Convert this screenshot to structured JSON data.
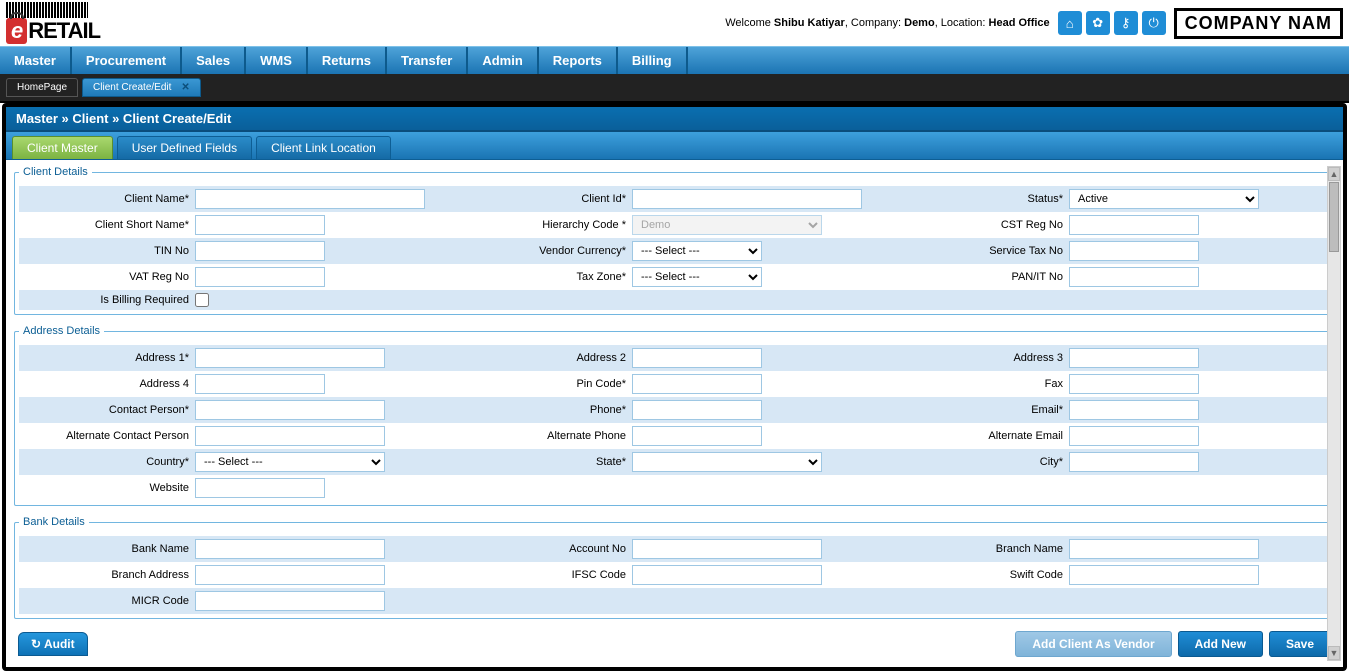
{
  "header": {
    "logo_text": "RETAIL",
    "logo_e": "e",
    "welcome_prefix": "Welcome ",
    "user": "Shibu Katiyar",
    "company_label": ", Company: ",
    "company": "Demo",
    "location_label": ", Location: ",
    "location": "Head Office",
    "company_box": "COMPANY NAM"
  },
  "menu": [
    "Master",
    "Procurement",
    "Sales",
    "WMS",
    "Returns",
    "Transfer",
    "Admin",
    "Reports",
    "Billing"
  ],
  "doc_tabs": {
    "home": "HomePage",
    "active": "Client Create/Edit"
  },
  "breadcrumb": "Master » Client » Client Create/Edit",
  "subtabs": [
    "Client Master",
    "User Defined Fields",
    "Client Link Location"
  ],
  "sections": {
    "client": {
      "legend": "Client Details",
      "labels": {
        "client_name": "Client Name*",
        "client_id": "Client Id*",
        "status": "Status*",
        "client_short_name": "Client Short Name*",
        "hierarchy_code": "Hierarchy Code *",
        "cst_reg_no": "CST Reg No",
        "tin_no": "TIN No",
        "vendor_currency": "Vendor Currency*",
        "service_tax_no": "Service Tax No",
        "vat_reg_no": "VAT Reg No",
        "tax_zone": "Tax Zone*",
        "pan_it_no": "PAN/IT No",
        "is_billing": "Is Billing Required"
      },
      "values": {
        "status_selected": "Active",
        "hierarchy_selected": "Demo",
        "select_placeholder": "--- Select ---"
      }
    },
    "address": {
      "legend": "Address Details",
      "labels": {
        "address1": "Address 1*",
        "address2": "Address 2",
        "address3": "Address 3",
        "address4": "Address 4",
        "pincode": "Pin Code*",
        "fax": "Fax",
        "contact_person": "Contact Person*",
        "phone": "Phone*",
        "email": "Email*",
        "alt_contact": "Alternate Contact Person",
        "alt_phone": "Alternate Phone",
        "alt_email": "Alternate Email",
        "country": "Country*",
        "state": "State*",
        "city": "City*",
        "website": "Website"
      },
      "values": {
        "select_placeholder": "--- Select ---"
      }
    },
    "bank": {
      "legend": "Bank Details",
      "labels": {
        "bank_name": "Bank Name",
        "account_no": "Account No",
        "branch_name": "Branch Name",
        "branch_address": "Branch Address",
        "ifsc": "IFSC Code",
        "swift": "Swift Code",
        "micr": "MICR Code"
      }
    }
  },
  "buttons": {
    "audit": "Audit",
    "add_vendor": "Add Client As Vendor",
    "add_new": "Add New",
    "save": "Save"
  }
}
